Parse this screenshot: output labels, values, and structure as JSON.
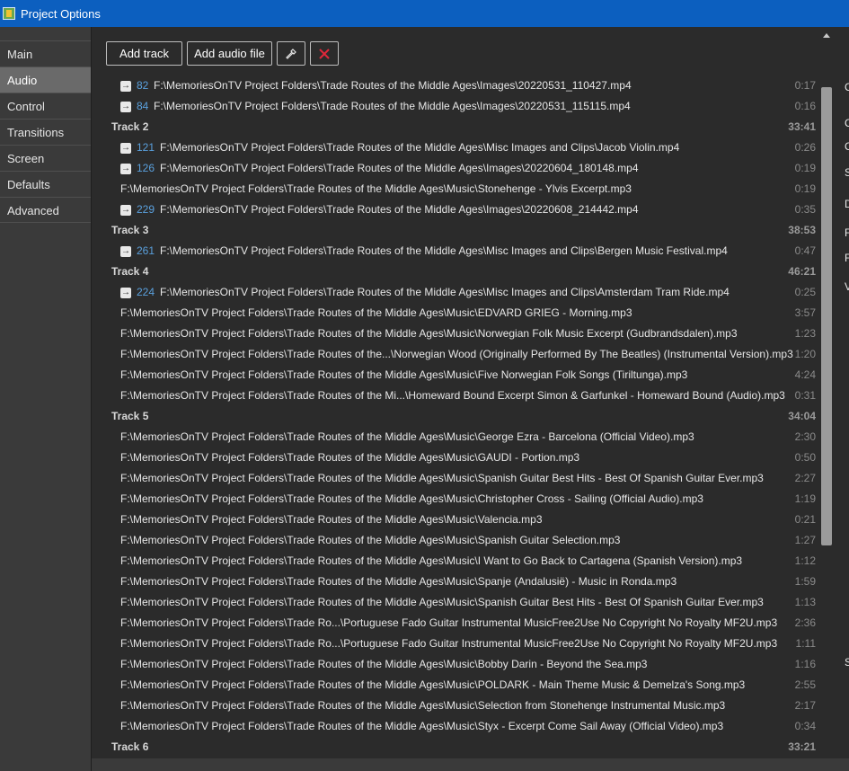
{
  "window": {
    "title": "Project Options"
  },
  "sidebar": {
    "items": [
      {
        "label": "Main",
        "active": false
      },
      {
        "label": "Audio",
        "active": true
      },
      {
        "label": "Control",
        "active": false
      },
      {
        "label": "Transitions",
        "active": false
      },
      {
        "label": "Screen",
        "active": false
      },
      {
        "label": "Defaults",
        "active": false
      },
      {
        "label": "Advanced",
        "active": false
      }
    ]
  },
  "toolbar": {
    "add_track": "Add track",
    "add_audio_file": "Add audio file",
    "tool_icon": "wrench-icon",
    "delete_icon": "delete-x-icon"
  },
  "rows": [
    {
      "kind": "slide",
      "num": "82",
      "path": "F:\\MemoriesOnTV Project Folders\\Trade Routes of the Middle Ages\\Images\\20220531_110427.mp4",
      "dur": "0:17"
    },
    {
      "kind": "slide",
      "num": "84",
      "path": "F:\\MemoriesOnTV Project Folders\\Trade Routes of the Middle Ages\\Images\\20220531_115115.mp4",
      "dur": "0:16"
    },
    {
      "kind": "track",
      "label": "Track 2",
      "dur": "33:41"
    },
    {
      "kind": "slide",
      "num": "121",
      "path": "F:\\MemoriesOnTV Project Folders\\Trade Routes of the Middle Ages\\Misc Images and Clips\\Jacob Violin.mp4",
      "dur": "0:26"
    },
    {
      "kind": "slide",
      "num": "126",
      "path": "F:\\MemoriesOnTV Project Folders\\Trade Routes of the Middle Ages\\Images\\20220604_180148.mp4",
      "dur": "0:19"
    },
    {
      "kind": "file",
      "path": "F:\\MemoriesOnTV Project Folders\\Trade Routes of the Middle Ages\\Music\\Stonehenge - Ylvis Excerpt.mp3",
      "dur": "0:19"
    },
    {
      "kind": "slide",
      "num": "229",
      "path": "F:\\MemoriesOnTV Project Folders\\Trade Routes of the Middle Ages\\Images\\20220608_214442.mp4",
      "dur": "0:35"
    },
    {
      "kind": "track",
      "label": "Track 3",
      "dur": "38:53"
    },
    {
      "kind": "slide",
      "num": "261",
      "path": "F:\\MemoriesOnTV Project Folders\\Trade Routes of the Middle Ages\\Misc Images and Clips\\Bergen Music Festival.mp4",
      "dur": "0:47"
    },
    {
      "kind": "track",
      "label": "Track 4",
      "dur": "46:21"
    },
    {
      "kind": "slide",
      "num": "224",
      "path": "F:\\MemoriesOnTV Project Folders\\Trade Routes of the Middle Ages\\Misc Images and Clips\\Amsterdam Tram Ride.mp4",
      "dur": "0:25"
    },
    {
      "kind": "file",
      "path": "F:\\MemoriesOnTV Project Folders\\Trade Routes of the Middle Ages\\Music\\EDVARD GRIEG - Morning.mp3",
      "dur": "3:57"
    },
    {
      "kind": "file",
      "path": "F:\\MemoriesOnTV Project Folders\\Trade Routes of the Middle Ages\\Music\\Norwegian Folk Music Excerpt (Gudbrandsdalen).mp3",
      "dur": "1:23"
    },
    {
      "kind": "file",
      "path": "F:\\MemoriesOnTV Project Folders\\Trade Routes of the...\\Norwegian Wood (Originally Performed By The Beatles) (Instrumental Version).mp3",
      "dur": "1:20"
    },
    {
      "kind": "file",
      "path": "F:\\MemoriesOnTV Project Folders\\Trade Routes of the Middle Ages\\Music\\Five Norwegian Folk Songs (Tiriltunga).mp3",
      "dur": "4:24"
    },
    {
      "kind": "file",
      "path": "F:\\MemoriesOnTV Project Folders\\Trade Routes of the Mi...\\Homeward Bound Excerpt Simon & Garfunkel - Homeward Bound (Audio).mp3",
      "dur": "0:31"
    },
    {
      "kind": "track",
      "label": "Track 5",
      "dur": "34:04"
    },
    {
      "kind": "file",
      "path": "F:\\MemoriesOnTV Project Folders\\Trade Routes of the Middle Ages\\Music\\George Ezra - Barcelona (Official Video).mp3",
      "dur": "2:30"
    },
    {
      "kind": "file",
      "path": "F:\\MemoriesOnTV Project Folders\\Trade Routes of the Middle Ages\\Music\\GAUDI - Portion.mp3",
      "dur": "0:50"
    },
    {
      "kind": "file",
      "path": "F:\\MemoriesOnTV Project Folders\\Trade Routes of the Middle Ages\\Music\\Spanish Guitar Best Hits - Best Of Spanish Guitar Ever.mp3",
      "dur": "2:27"
    },
    {
      "kind": "file",
      "path": "F:\\MemoriesOnTV Project Folders\\Trade Routes of the Middle Ages\\Music\\Christopher Cross - Sailing (Official Audio).mp3",
      "dur": "1:19"
    },
    {
      "kind": "file",
      "path": "F:\\MemoriesOnTV Project Folders\\Trade Routes of the Middle Ages\\Music\\Valencia.mp3",
      "dur": "0:21"
    },
    {
      "kind": "file",
      "path": "F:\\MemoriesOnTV Project Folders\\Trade Routes of the Middle Ages\\Music\\Spanish Guitar Selection.mp3",
      "dur": "1:27"
    },
    {
      "kind": "file",
      "path": "F:\\MemoriesOnTV Project Folders\\Trade Routes of the Middle Ages\\Music\\I Want to Go Back to Cartagena (Spanish Version).mp3",
      "dur": "1:12"
    },
    {
      "kind": "file",
      "path": "F:\\MemoriesOnTV Project Folders\\Trade Routes of the Middle Ages\\Music\\Spanje (Andalusië) - Music in Ronda.mp3",
      "dur": "1:59"
    },
    {
      "kind": "file",
      "path": "F:\\MemoriesOnTV Project Folders\\Trade Routes of the Middle Ages\\Music\\Spanish Guitar Best Hits - Best Of Spanish Guitar Ever.mp3",
      "dur": "1:13"
    },
    {
      "kind": "file",
      "path": "F:\\MemoriesOnTV Project Folders\\Trade Ro...\\Portuguese Fado Guitar Instrumental   MusicFree2Use   No Copyright   No Royalty   MF2U.mp3",
      "dur": "2:36"
    },
    {
      "kind": "file",
      "path": "F:\\MemoriesOnTV Project Folders\\Trade Ro...\\Portuguese Fado Guitar Instrumental   MusicFree2Use   No Copyright   No Royalty   MF2U.mp3",
      "dur": "1:11"
    },
    {
      "kind": "file",
      "path": "F:\\MemoriesOnTV Project Folders\\Trade Routes of the Middle Ages\\Music\\Bobby Darin - Beyond the Sea.mp3",
      "dur": "1:16"
    },
    {
      "kind": "file",
      "path": "F:\\MemoriesOnTV Project Folders\\Trade Routes of the Middle Ages\\Music\\POLDARK - Main Theme Music & Demelza's Song.mp3",
      "dur": "2:55"
    },
    {
      "kind": "file",
      "path": "F:\\MemoriesOnTV Project Folders\\Trade Routes of the Middle Ages\\Music\\Selection from Stonehenge Instrumental Music.mp3",
      "dur": "2:17"
    },
    {
      "kind": "file",
      "path": "F:\\MemoriesOnTV Project Folders\\Trade Routes of the Middle Ages\\Music\\Styx - Excerpt Come Sail Away (Official Video).mp3",
      "dur": "0:34"
    },
    {
      "kind": "track",
      "label": "Track 6",
      "dur": "33:21"
    }
  ],
  "right_panel": {
    "clipped_chars": [
      "C",
      "C",
      "C",
      "S",
      "D",
      "F",
      "F",
      "V",
      "S"
    ]
  },
  "colors": {
    "titlebar": "#0c5fbf",
    "slide_number": "#5aa0dd",
    "delete_icon": "#e0283a"
  }
}
